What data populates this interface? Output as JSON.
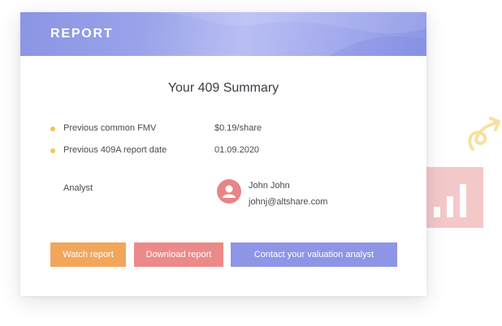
{
  "colors": {
    "header_gradient_start": "#8b95e4",
    "header_gradient_light": "#b9bff3",
    "bullet": "#f3c74f",
    "avatar": "#e88586",
    "watch_button": "#f2a65a",
    "download_button": "#ec8a89",
    "contact_button": "#8e95e6",
    "chart_tile": "#f3c8c9",
    "squiggle": "#f7e0a0"
  },
  "report": {
    "header_title": "REPORT",
    "summary_title": "Your 409 Summary",
    "details": [
      {
        "label": "Previous common FMV",
        "value": "$0.19/share",
        "bullet_icon": "dot-bullet-icon"
      },
      {
        "label": "Previous 409A report date",
        "value": "01.09.2020",
        "bullet_icon": "dot-bullet-icon"
      }
    ],
    "analyst": {
      "label": "Analyst",
      "name": "John John",
      "email": "johnj@altshare.com",
      "avatar_icon": "user-avatar-icon"
    },
    "actions": {
      "watch_label": "Watch report",
      "download_label": "Download report",
      "contact_label": "Contact your valuation analyst"
    }
  },
  "decorations": {
    "chart_icon": "bar-chart-icon",
    "arrow_icon": "squiggle-arrow-icon"
  }
}
